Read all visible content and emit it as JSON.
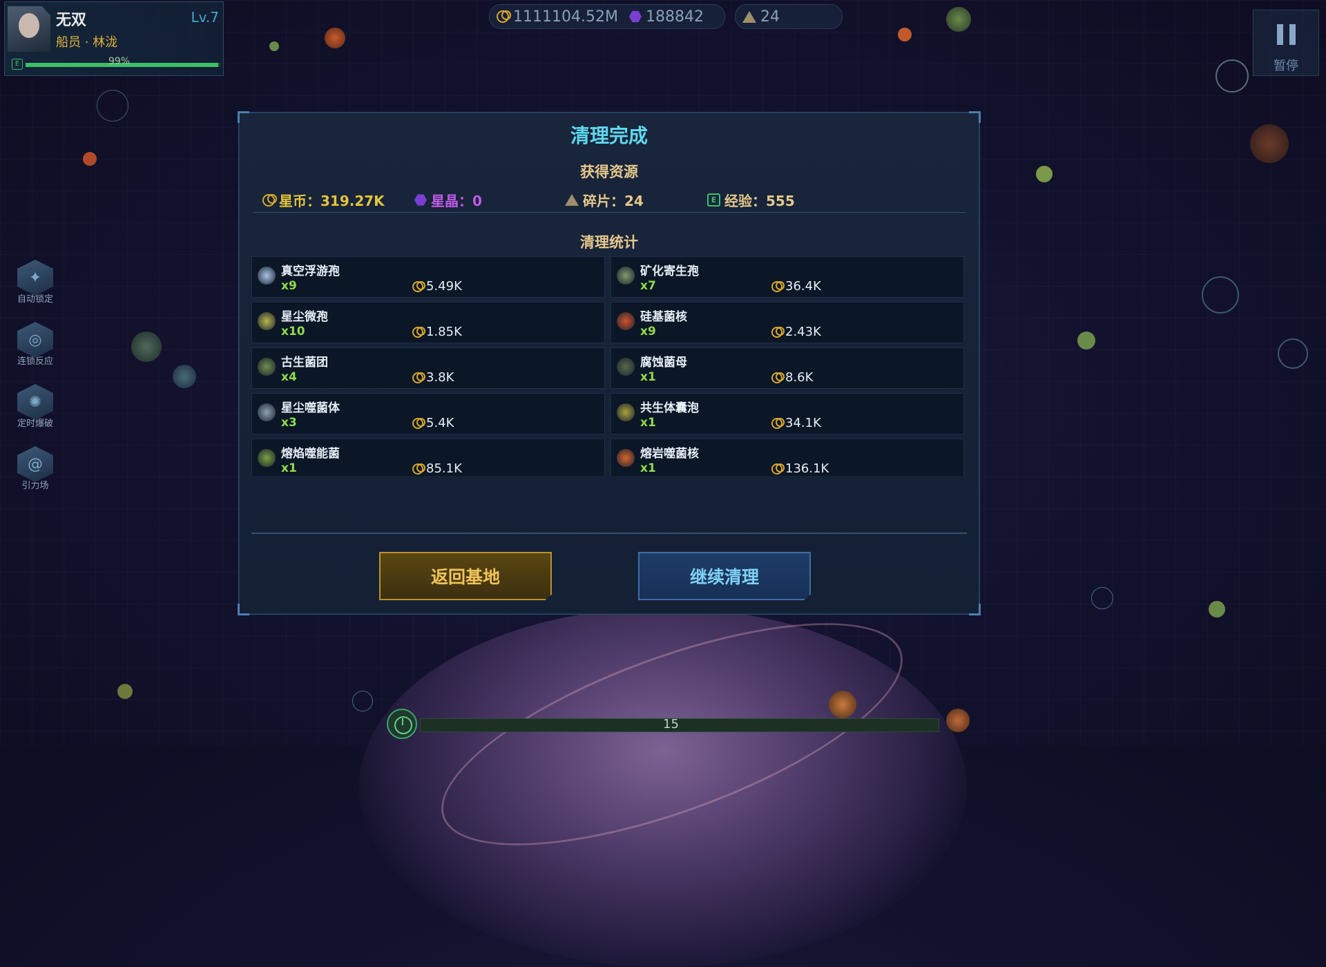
{
  "player": {
    "name": "无双",
    "level": "Lv.7",
    "role": "船员 · 林泷",
    "exp_percent_label": "99%",
    "exp_fraction": 0.99
  },
  "top_resources": {
    "coins": "1111104.52M",
    "crystals": "188842",
    "fragments": "24"
  },
  "pause": {
    "label": "暂停",
    "icon": "pause-icon"
  },
  "skills": [
    {
      "label": "自动锁定",
      "icon": "auto-lock-icon"
    },
    {
      "label": "连锁反应",
      "icon": "chain-reaction-icon"
    },
    {
      "label": "定时爆破",
      "icon": "timed-blast-icon"
    },
    {
      "label": "引力场",
      "icon": "gravity-field-icon"
    }
  ],
  "timer": {
    "text": "15",
    "progress": 0.0,
    "icon": "clock-icon"
  },
  "modal": {
    "title": "清理完成",
    "rewards_heading": "获得资源",
    "rewards": {
      "coins": "星币：319.27K",
      "crystals": "星晶：0",
      "fragments": "碎片：24",
      "exp": "经验：555"
    },
    "stats_heading": "清理统计",
    "stats": [
      {
        "name": "真空浮游孢",
        "count": "x9",
        "value": "5.49K",
        "color": "#a9c3e6"
      },
      {
        "name": "矿化寄生孢",
        "count": "x7",
        "value": "36.4K",
        "color": "#7f9a6a"
      },
      {
        "name": "星尘微孢",
        "count": "x10",
        "value": "1.85K",
        "color": "#b6b64a"
      },
      {
        "name": "硅基菌核",
        "count": "x9",
        "value": "2.43K",
        "color": "#d0542c"
      },
      {
        "name": "古生菌团",
        "count": "x4",
        "value": "3.8K",
        "color": "#6f8e4c"
      },
      {
        "name": "腐蚀菌母",
        "count": "x1",
        "value": "8.6K",
        "color": "#5a6a4c"
      },
      {
        "name": "星尘噬菌体",
        "count": "x3",
        "value": "5.4K",
        "color": "#8fa2b0"
      },
      {
        "name": "共生体囊泡",
        "count": "x1",
        "value": "34.1K",
        "color": "#a9a338"
      },
      {
        "name": "熔焰噬能菌",
        "count": "x1",
        "value": "85.1K",
        "color": "#7aa040"
      },
      {
        "name": "熔岩噬菌核",
        "count": "x1",
        "value": "136.1K",
        "color": "#d7642c"
      }
    ],
    "buttons": {
      "home": "返回基地",
      "continue": "继续清理"
    }
  },
  "colors": {
    "coin": "#d9a92c",
    "crystal": "#b04ae0",
    "fragment": "#e6c88c",
    "exp": "#3cc06a",
    "title": "#5fd8ee"
  }
}
